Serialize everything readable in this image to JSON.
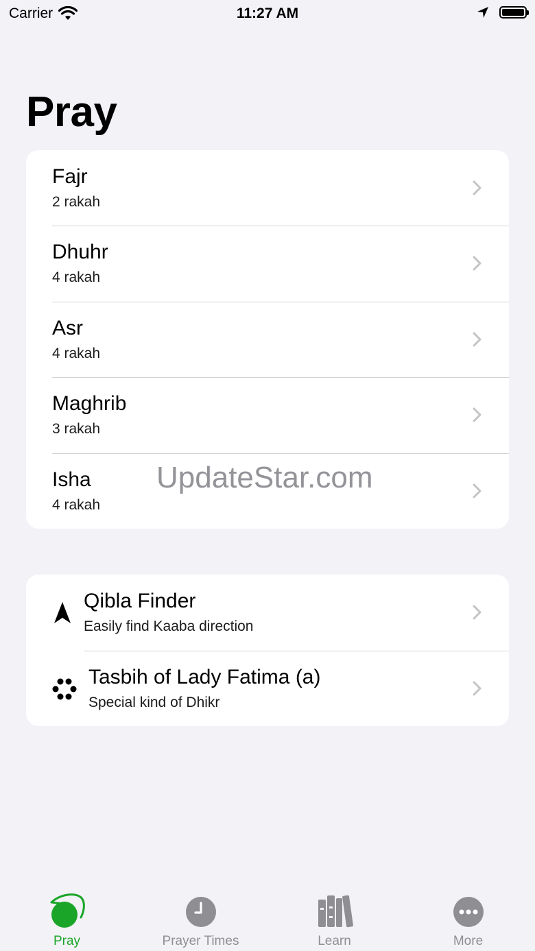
{
  "status_bar": {
    "carrier": "Carrier",
    "time": "11:27 AM"
  },
  "page": {
    "title": "Pray"
  },
  "prayers": [
    {
      "name": "Fajr",
      "rakah": "2 rakah"
    },
    {
      "name": "Dhuhr",
      "rakah": "4 rakah"
    },
    {
      "name": "Asr",
      "rakah": "4 rakah"
    },
    {
      "name": "Maghrib",
      "rakah": "3 rakah"
    },
    {
      "name": "Isha",
      "rakah": "4 rakah"
    }
  ],
  "tools": [
    {
      "title": "Qibla Finder",
      "subtitle": "Easily find Kaaba direction",
      "icon": "location-arrow-icon"
    },
    {
      "title": "Tasbih of Lady Fatima (a)",
      "subtitle": "Special kind of Dhikr",
      "icon": "beads-icon"
    }
  ],
  "watermark": "UpdateStar.com",
  "tab_bar": {
    "tabs": [
      {
        "label": "Pray",
        "icon": "pray-icon",
        "active": true
      },
      {
        "label": "Prayer Times",
        "icon": "clock-icon",
        "active": false
      },
      {
        "label": "Learn",
        "icon": "books-icon",
        "active": false
      },
      {
        "label": "More",
        "icon": "ellipsis-icon",
        "active": false
      }
    ]
  },
  "colors": {
    "accent": "#1aa528",
    "background": "#f2f2f7",
    "inactive": "#8e8e93",
    "separator": "#d1d1d6",
    "chevron": "#c4c4c7"
  }
}
